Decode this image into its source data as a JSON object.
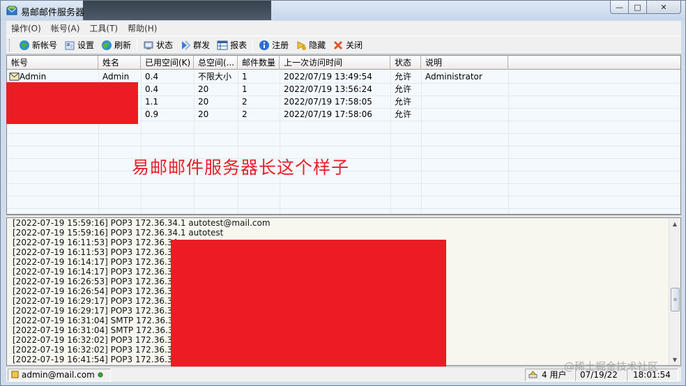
{
  "window": {
    "title": "易邮邮件服务器",
    "controls": {
      "minimize": "—",
      "maximize": "□",
      "close": "✕"
    }
  },
  "menu": [
    "操作(O)",
    "帐号(A)",
    "工具(T)",
    "帮助(H)"
  ],
  "toolbar": [
    {
      "label": "新帐号",
      "icon": "new-account-icon"
    },
    {
      "label": "设置",
      "icon": "settings-icon"
    },
    {
      "label": "刷新",
      "icon": "refresh-icon"
    },
    {
      "label": "状态",
      "icon": "status-icon"
    },
    {
      "label": "群发",
      "icon": "broadcast-icon"
    },
    {
      "label": "报表",
      "icon": "report-icon"
    },
    {
      "label": "注册",
      "icon": "info-icon"
    },
    {
      "label": "隐藏",
      "icon": "hide-icon"
    },
    {
      "label": "关闭",
      "icon": "close-x-icon"
    }
  ],
  "table": {
    "columns": [
      "帐号",
      "姓名",
      "已用空间(K)",
      "总空间(...",
      "邮件数量",
      "上一次访问时间",
      "状态",
      "说明"
    ],
    "rows": [
      [
        "Admin",
        "Admin",
        "0.4",
        "不限大小",
        "1",
        "2022/07/19 13:49:54",
        "允许",
        "Administrator"
      ],
      [
        "",
        "",
        "0.4",
        "20",
        "1",
        "2022/07/19 13:56:24",
        "允许",
        ""
      ],
      [
        "",
        "",
        "1.1",
        "20",
        "2",
        "2022/07/19 17:58:05",
        "允许",
        ""
      ],
      [
        "",
        "",
        "0.9",
        "20",
        "2",
        "2022/07/19 17:58:06",
        "允许",
        ""
      ]
    ]
  },
  "overlay_caption": "易邮邮件服务器长这个样子",
  "log": [
    "[2022-07-19 15:59:16] POP3 172.36.34.1 autotest@mail.com",
    "[2022-07-19 15:59:16] POP3 172.36.34.1 autotest",
    "[2022-07-19 16:11:53] POP3 172.36.34.",
    "[2022-07-19 16:11:53] POP3 172.36.34.",
    "[2022-07-19 16:14:17] POP3 172.36.34.",
    "[2022-07-19 16:14:17] POP3 172.36.34.",
    "[2022-07-19 16:26:53] POP3 172.36.34.",
    "[2022-07-19 16:26:54] POP3 172.36.34.",
    "[2022-07-19 16:29:17] POP3 172.36.34.",
    "[2022-07-19 16:29:17] POP3 172.36.34.",
    "[2022-07-19 16:31:04] SMTP 172.36.34.",
    "[2022-07-19 16:31:04] SMTP 172.36.34.",
    "[2022-07-19 16:32:02] POP3 172.36.34.",
    "[2022-07-19 16:32:02] POP3 172.36.34.",
    "[2022-07-19 16:41:54] POP3 172.36.34."
  ],
  "status_bar": {
    "account": "admin@mail.com",
    "users": "4 用户",
    "date": "07/19/22",
    "time": "18:01:54"
  },
  "watermark": "@稀土掘金技术社区",
  "colors": {
    "redaction": "#ec1c24",
    "caption": "#e8202a"
  }
}
